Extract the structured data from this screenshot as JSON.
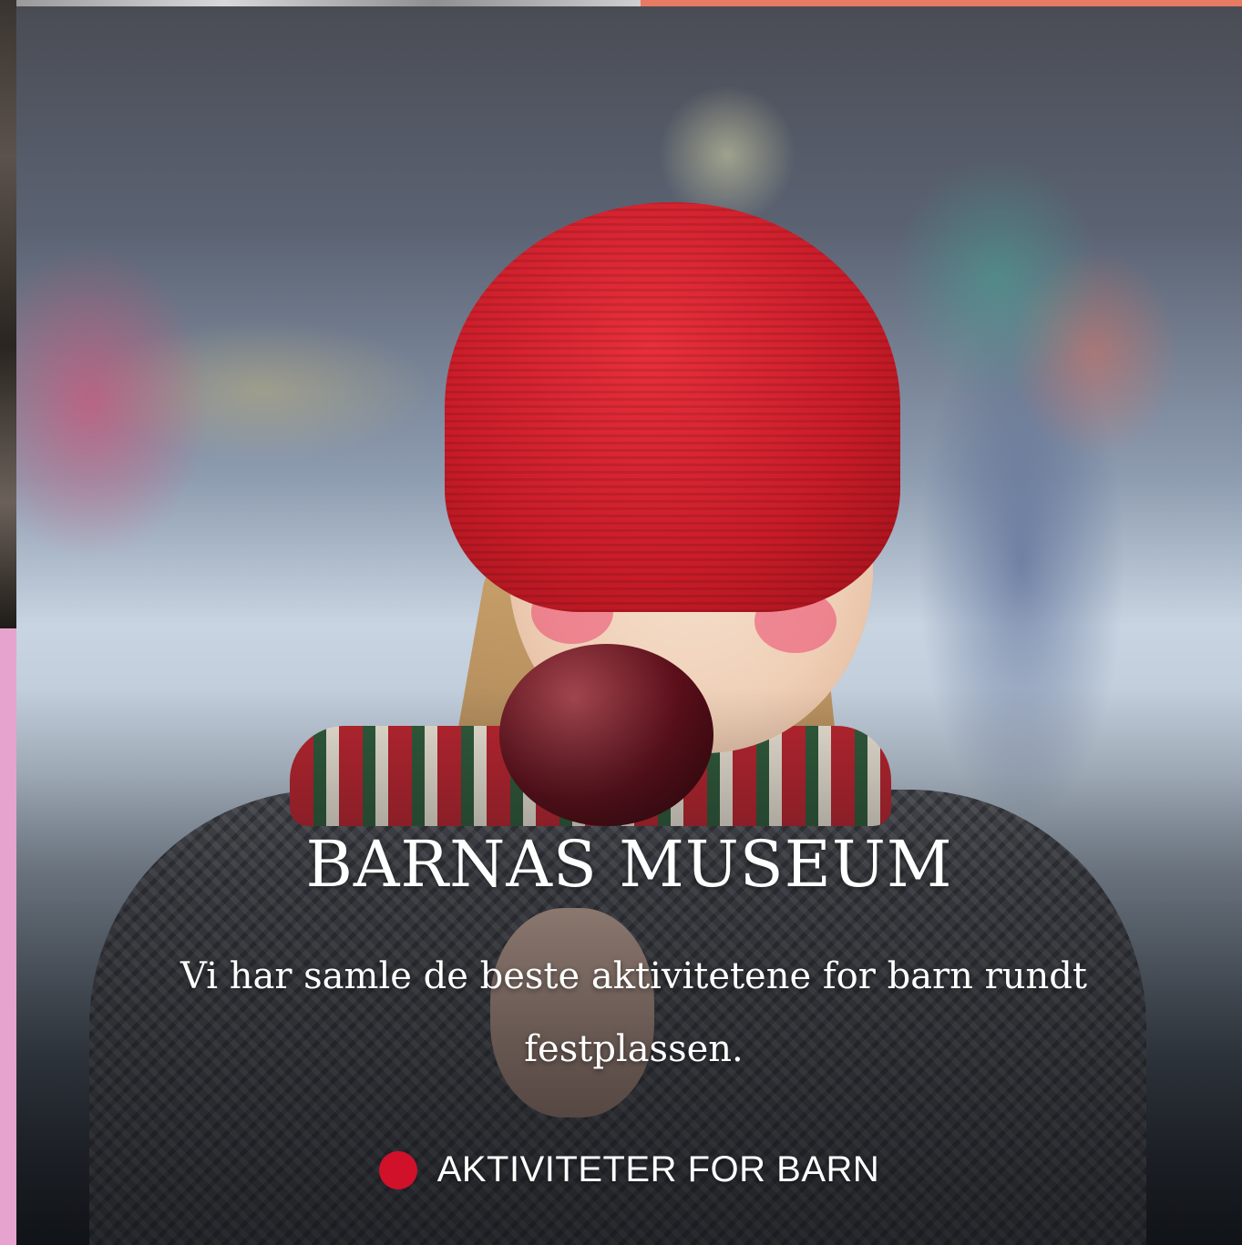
{
  "card": {
    "title": "BARNAS MUSEUM",
    "description": "Vi har samle de beste aktivitetene for barn rundt festplassen.",
    "category_label": "AKTIVITETER FOR BARN",
    "category_icon": "red-dot-icon",
    "accent_color": "#d1102a"
  }
}
